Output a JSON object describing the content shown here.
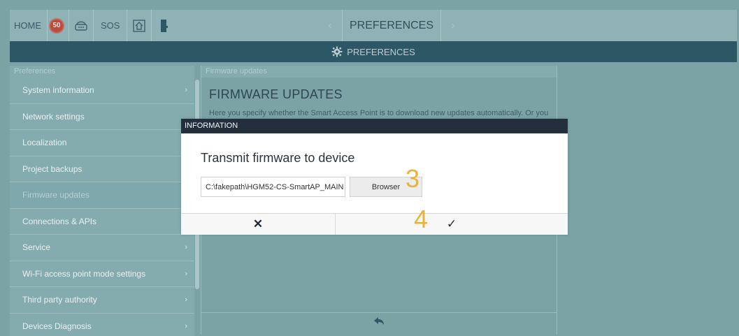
{
  "topbar": {
    "home_label": "HOME",
    "badge_count": "50",
    "sos_label": "SOS",
    "title": "PREFERENCES",
    "prev_glyph": "‹",
    "next_glyph": "›"
  },
  "header": {
    "title": "PREFERENCES"
  },
  "sidebar": {
    "heading": "Preferences",
    "items": [
      {
        "label": "System information",
        "chevron": "›"
      },
      {
        "label": "Network settings",
        "chevron": ""
      },
      {
        "label": "Localization",
        "chevron": ""
      },
      {
        "label": "Project backups",
        "chevron": ""
      },
      {
        "label": "Firmware updates",
        "chevron": ""
      },
      {
        "label": "Connections & APIs",
        "chevron": ""
      },
      {
        "label": "Service",
        "chevron": "›"
      },
      {
        "label": "Wi-Fi access point mode settings",
        "chevron": "›"
      },
      {
        "label": "Third party authority",
        "chevron": "›"
      },
      {
        "label": "Devices Diagnosis",
        "chevron": "›"
      }
    ]
  },
  "content": {
    "heading": "Firmware updates",
    "title": "FIRMWARE UPDATES",
    "text": "Here you specify whether the Smart Access Point is to download new updates automatically. Or you"
  },
  "dialog": {
    "header": "INFORMATION",
    "title": "Transmit firmware to device",
    "file_value": "C:\\fakepath\\HGM52-CS-SmartAP_MAIN",
    "browse_label": "Browser",
    "cancel_glyph": "✕",
    "ok_glyph": "✓",
    "annotations": {
      "step3": "3",
      "step4": "4"
    }
  },
  "colors": {
    "accent": "#2e5766",
    "annotation": "#e6b43c",
    "badge": "#b84c3f"
  }
}
